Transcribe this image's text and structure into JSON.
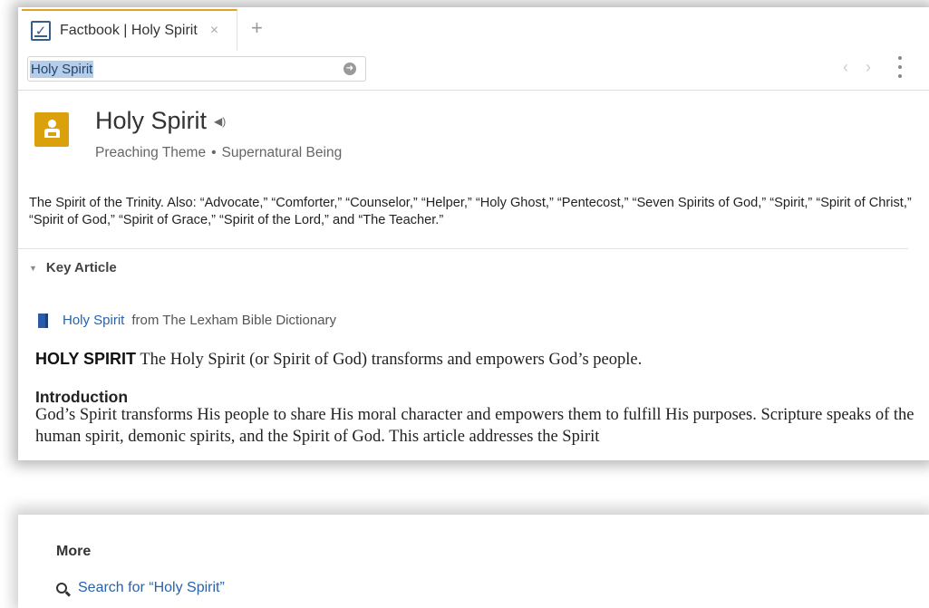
{
  "tab": {
    "title": "Factbook | Holy Spirit",
    "close_glyph": "×",
    "add_glyph": "+"
  },
  "toolbar": {
    "search_value": "Holy Spirit",
    "go_glyph": "➲",
    "back_glyph": "‹",
    "forward_glyph": "›"
  },
  "entity": {
    "title": "Holy Spirit",
    "speaker_glyph": "🔊",
    "type": "Preaching Theme",
    "separator": "•",
    "category": "Supernatural Being",
    "description": "The Spirit of the Trinity. Also: “Advocate,” “Comforter,” “Counselor,” “Helper,” “Holy Ghost,” “Pentecost,” “Seven Spirits of God,” “Spirit,” “Spirit of Christ,” “Spirit of God,” “Spirit of Grace,” “Spirit of the Lord,” and “The Teacher.”"
  },
  "key_article": {
    "header": "Key Article",
    "caret": "▼",
    "source_title": "Holy Spirit",
    "source_from": "from The Lexham Bible Dictionary",
    "headword": "HOLY SPIRIT",
    "lead": "The Holy Spirit (or Spirit of God) transforms and empowers God’s people.",
    "intro_heading": "Introduction",
    "intro_text": "God’s Spirit transforms His people to share His moral character and empowers them to fulfill His purposes. Scripture speaks of the human spirit, demonic spirits, and the Spirit of God. This article addresses the Spirit"
  },
  "more": {
    "label": "More",
    "search_link": "Search for “Holy Spirit”"
  },
  "colors": {
    "accent": "#e0a12a",
    "entity_icon_bg": "#dba10d",
    "link": "#2762ad"
  }
}
